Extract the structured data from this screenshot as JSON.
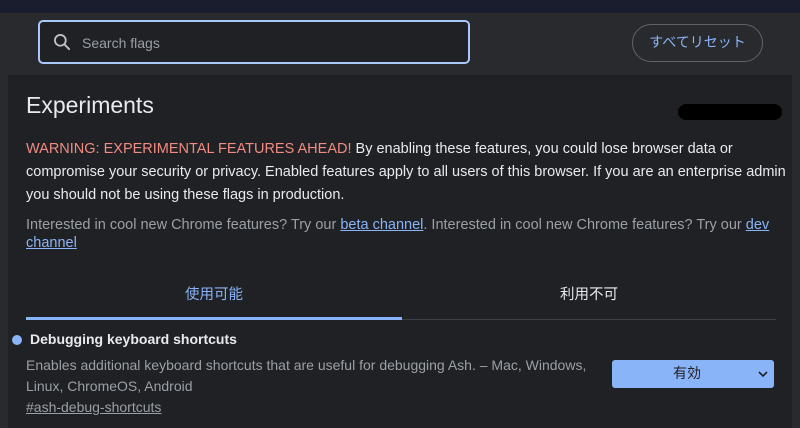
{
  "search": {
    "placeholder": "Search flags",
    "value": ""
  },
  "header": {
    "reset_all_label": "すべてリセット"
  },
  "page": {
    "title": "Experiments"
  },
  "warning": {
    "label": "WARNING: EXPERIMENTAL FEATURES AHEAD!",
    "text": " By enabling these features, you could lose browser data or compromise your security or privacy. Enabled features apply to all users of this browser. If you are an enterprise admin you should not be using these flags in production."
  },
  "channels": {
    "text1": "Interested in cool new Chrome features? Try our ",
    "beta_link": "beta channel",
    "text2": ". Interested in cool new Chrome features? Try our ",
    "dev_link": "dev channel"
  },
  "tabs": [
    {
      "label": "使用可能",
      "selected": true
    },
    {
      "label": "利用不可",
      "selected": false
    }
  ],
  "flags": [
    {
      "name": "Debugging keyboard shortcuts",
      "description": "Enables additional keyboard shortcuts that are useful for debugging Ash. – Mac, Windows, Linux, ChromeOS, Android",
      "link": "#ash-debug-shortcuts",
      "selected_option": "有効"
    }
  ],
  "colors": {
    "accent": "#8ab4f8",
    "warning": "#f28b82",
    "background": "#202124",
    "header": "#292a2d"
  }
}
